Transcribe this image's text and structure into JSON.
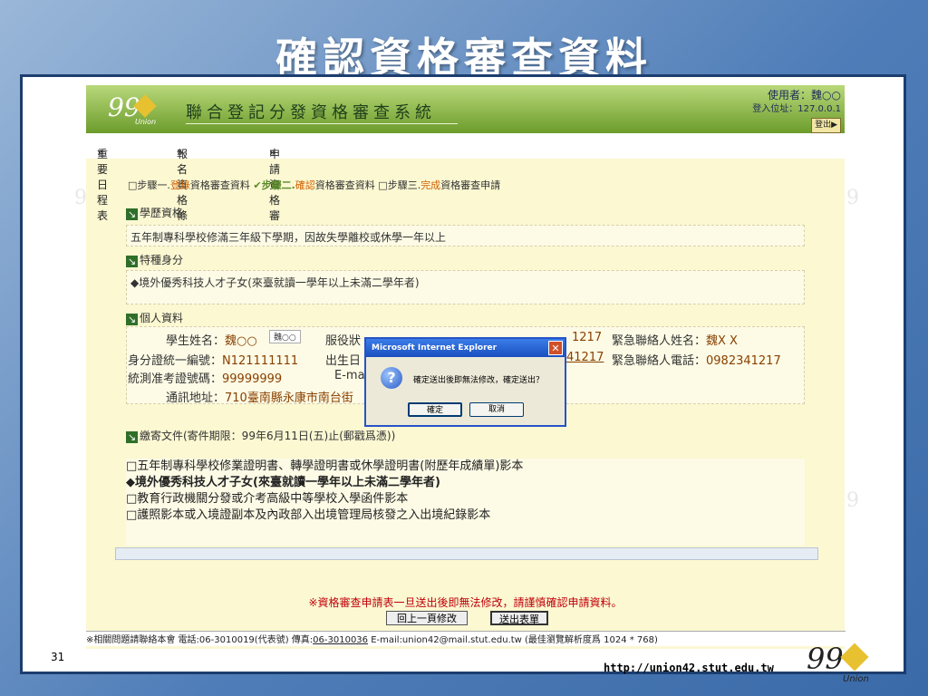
{
  "slide": {
    "title": "確認資格審查資料",
    "page_number": "31",
    "footer_url": "http://union42.stut.edu.tw",
    "logo_number": "99",
    "logo_sub": "Union"
  },
  "app": {
    "title": "聯合登記分發資格審查系統",
    "user_label": "使用者：魏○○",
    "ip_label": "登入位址：127.0.0.1",
    "logout": "登出",
    "menu": [
      "重要日程表",
      "報名資格條款",
      "申請資格審查"
    ]
  },
  "steps": {
    "s1_box": "□步驟一.",
    "s1_hl": "登錄",
    "s1_rest": "資格審查資料",
    "s2_box": "✔步驟二.",
    "s2_hl": "確認",
    "s2_rest": "資格審查資料",
    "s3_box": "□步驟三.",
    "s3_hl": "完成",
    "s3_rest": "資格審查申請"
  },
  "education": {
    "heading": "學歷資格",
    "value": "五年制專科學校修滿三年級下學期，因故失學離校或休學一年以上"
  },
  "special": {
    "heading": "特種身分",
    "value": "◆境外優秀科技人才子女(來臺就讀一學年以上未滿二學年者)"
  },
  "personal": {
    "heading": "個人資料",
    "name_label": "學生姓名：",
    "name_value": "魏○○",
    "name_tooltip": "魏○○",
    "service_label": "服役狀",
    "phone_partial": "1217",
    "emergency_name_label": "緊急聯絡人姓名：",
    "emergency_name_value": "魏X X",
    "id_label": "身分證統一編號：",
    "id_value": "N121111111",
    "birth_label": "出生日",
    "birth_partial": "41217",
    "emergency_phone_label": "緊急聯絡人電話：",
    "emergency_phone_value": "0982341217",
    "exam_label": "統測准考證號碼：",
    "exam_value": "99999999",
    "email_label": "E-ma",
    "address_label": "通訊地址：",
    "address_value": "710臺南縣永康市南台街"
  },
  "documents": {
    "heading": "繳寄文件(寄件期限：99年6月11日(五)止(郵戳爲憑))",
    "items": [
      "□五年制專科學校修業證明書、轉學證明書或休學證明書(附歷年成績單)影本",
      "◆境外優秀科技人才子女(來臺就讀一學年以上未滿二學年者)",
      "□教育行政機關分發或介考高級中等學校入學函件影本",
      "□護照影本或入境證副本及內政部入出境管理局核發之入出境紀錄影本"
    ]
  },
  "notice": "※資格審查申請表一旦送出後即無法修改，請謹慎確認申請資料。",
  "buttons": {
    "back": "回上一頁修改",
    "submit": "送出表單"
  },
  "status_bar": {
    "prefix": "※相關問題請聯絡本會 電話:06-3010019(代表號) 傳真:",
    "fax": "06-3010036",
    "suffix": " E-mail:union42@mail.stut.edu.tw (最佳瀏覽解析度爲 1024 * 768)"
  },
  "dialog": {
    "title": "Microsoft Internet Explorer",
    "close": "✕",
    "icon": "?",
    "message": "確定送出後即無法修改，確定送出？",
    "ok": "確定",
    "cancel": "取消"
  }
}
